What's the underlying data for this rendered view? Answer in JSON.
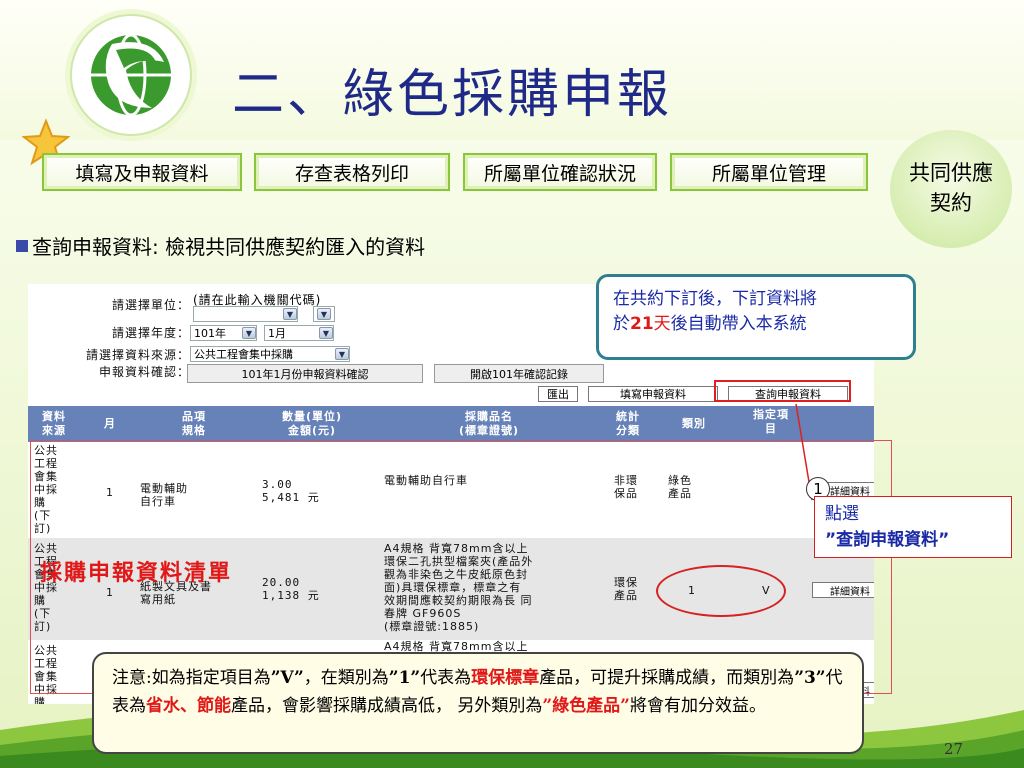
{
  "slide": {
    "title": "二、綠色採購申報",
    "nav": [
      "填寫及申報資料",
      "存查表格列印",
      "所屬單位確認狀況",
      "所屬單位管理"
    ],
    "circle": [
      "共同供應",
      "契約"
    ],
    "heading": "查詢申報資料: 檢視共同供應契約匯入的資料",
    "page_number": "27"
  },
  "form": {
    "unit_label": "請選擇單位：",
    "unit_hint": "(請在此輸入機關代碼)",
    "year_label": "請選擇年度：",
    "year_value": "101年",
    "month_value": "1月",
    "source_label": "請選擇資料來源：",
    "source_value": "公共工程會集中採購",
    "confirm_label": "申報資料確認：",
    "confirm_btn1": "101年1月份申報資料確認",
    "confirm_btn2": "開啟101年確認記錄",
    "action_export": "匯出",
    "action_fill": "填寫申報資料",
    "action_query": "查詢申報資料"
  },
  "table": {
    "headers": [
      [
        "資料",
        "來源"
      ],
      [
        "月"
      ],
      [
        "品項",
        "規格"
      ],
      [
        "數量(單位)",
        "金額(元)"
      ],
      [
        "採購品名",
        "(標章證號)"
      ],
      [
        "統計",
        "分類"
      ],
      [
        "類別"
      ],
      [
        "指定項",
        "目"
      ]
    ],
    "rows": [
      {
        "source": [
          "公共",
          "工程",
          "會集",
          "中採",
          "購",
          "(下",
          "訂)"
        ],
        "month": "1",
        "item": [
          "電動輔助",
          "自行車"
        ],
        "qty": [
          "3.00",
          "5,481 元"
        ],
        "name": [
          "電動輔助自行車"
        ],
        "stat": [
          "非環",
          "保品"
        ],
        "category": [
          "綠色",
          "產品"
        ],
        "designated": "",
        "detail": "詳細資料"
      },
      {
        "source": [
          "公共",
          "工程",
          "會集",
          "中採",
          "購",
          "(下",
          "訂)"
        ],
        "month": "1",
        "item": [
          "紙製文具及書",
          "寫用紙"
        ],
        "qty": [
          "20.00",
          "1,138 元"
        ],
        "name": [
          "A4規格 背寬78mm含以上",
          "環保二孔拱型檔案夾(產品外",
          "觀為非染色之牛皮紙原色封",
          "面)具環保標章，標章之有",
          "效期間應較契約期限為長 同",
          "春牌 GF960S",
          "(標章證號:1885)"
        ],
        "stat": [
          "環保",
          "產品"
        ],
        "category": "1",
        "designated": "V",
        "detail": "詳細資料"
      },
      {
        "source": [
          "公共",
          "工程",
          "會集",
          "中採",
          "購"
        ],
        "month": "",
        "item": [],
        "qty": [],
        "name": [
          "A4規格 背寬78mm含以上"
        ],
        "stat": [],
        "category": "",
        "designated": "",
        "detail": "詳細資料"
      }
    ]
  },
  "callouts": {
    "top": {
      "line1": "在共約下訂後，下訂資料將",
      "line2_a": "於",
      "line2_days": "21",
      "line2_unit": "天",
      "line2_b": "後自動帶入本系統"
    },
    "step_number": "1",
    "step_line1": "點選",
    "step_line2": "”查詢申報資料”",
    "red_label": "採購申報資料清單"
  },
  "note": {
    "p1": "注意:如為指定項目為",
    "v": "”V”",
    "p2": "，在類別為",
    "one": "”1”",
    "p3": "代表為",
    "eco": "環保標章",
    "p4": "產品，可提升採購成績，而類別為",
    "three": "”3”",
    "p5": "代表為",
    "saving": "省水、節能",
    "p6": "產品，會影響採購成績高低， 另外類別為",
    "green": "”綠色產品”",
    "p7": "將會有加分效益。"
  },
  "colors": {
    "title": "#1f2a88",
    "accent_green": "#8ac63a",
    "table_header": "#6682b8",
    "highlight_red": "#e01818",
    "callout_blue": "#1a2aa6"
  }
}
